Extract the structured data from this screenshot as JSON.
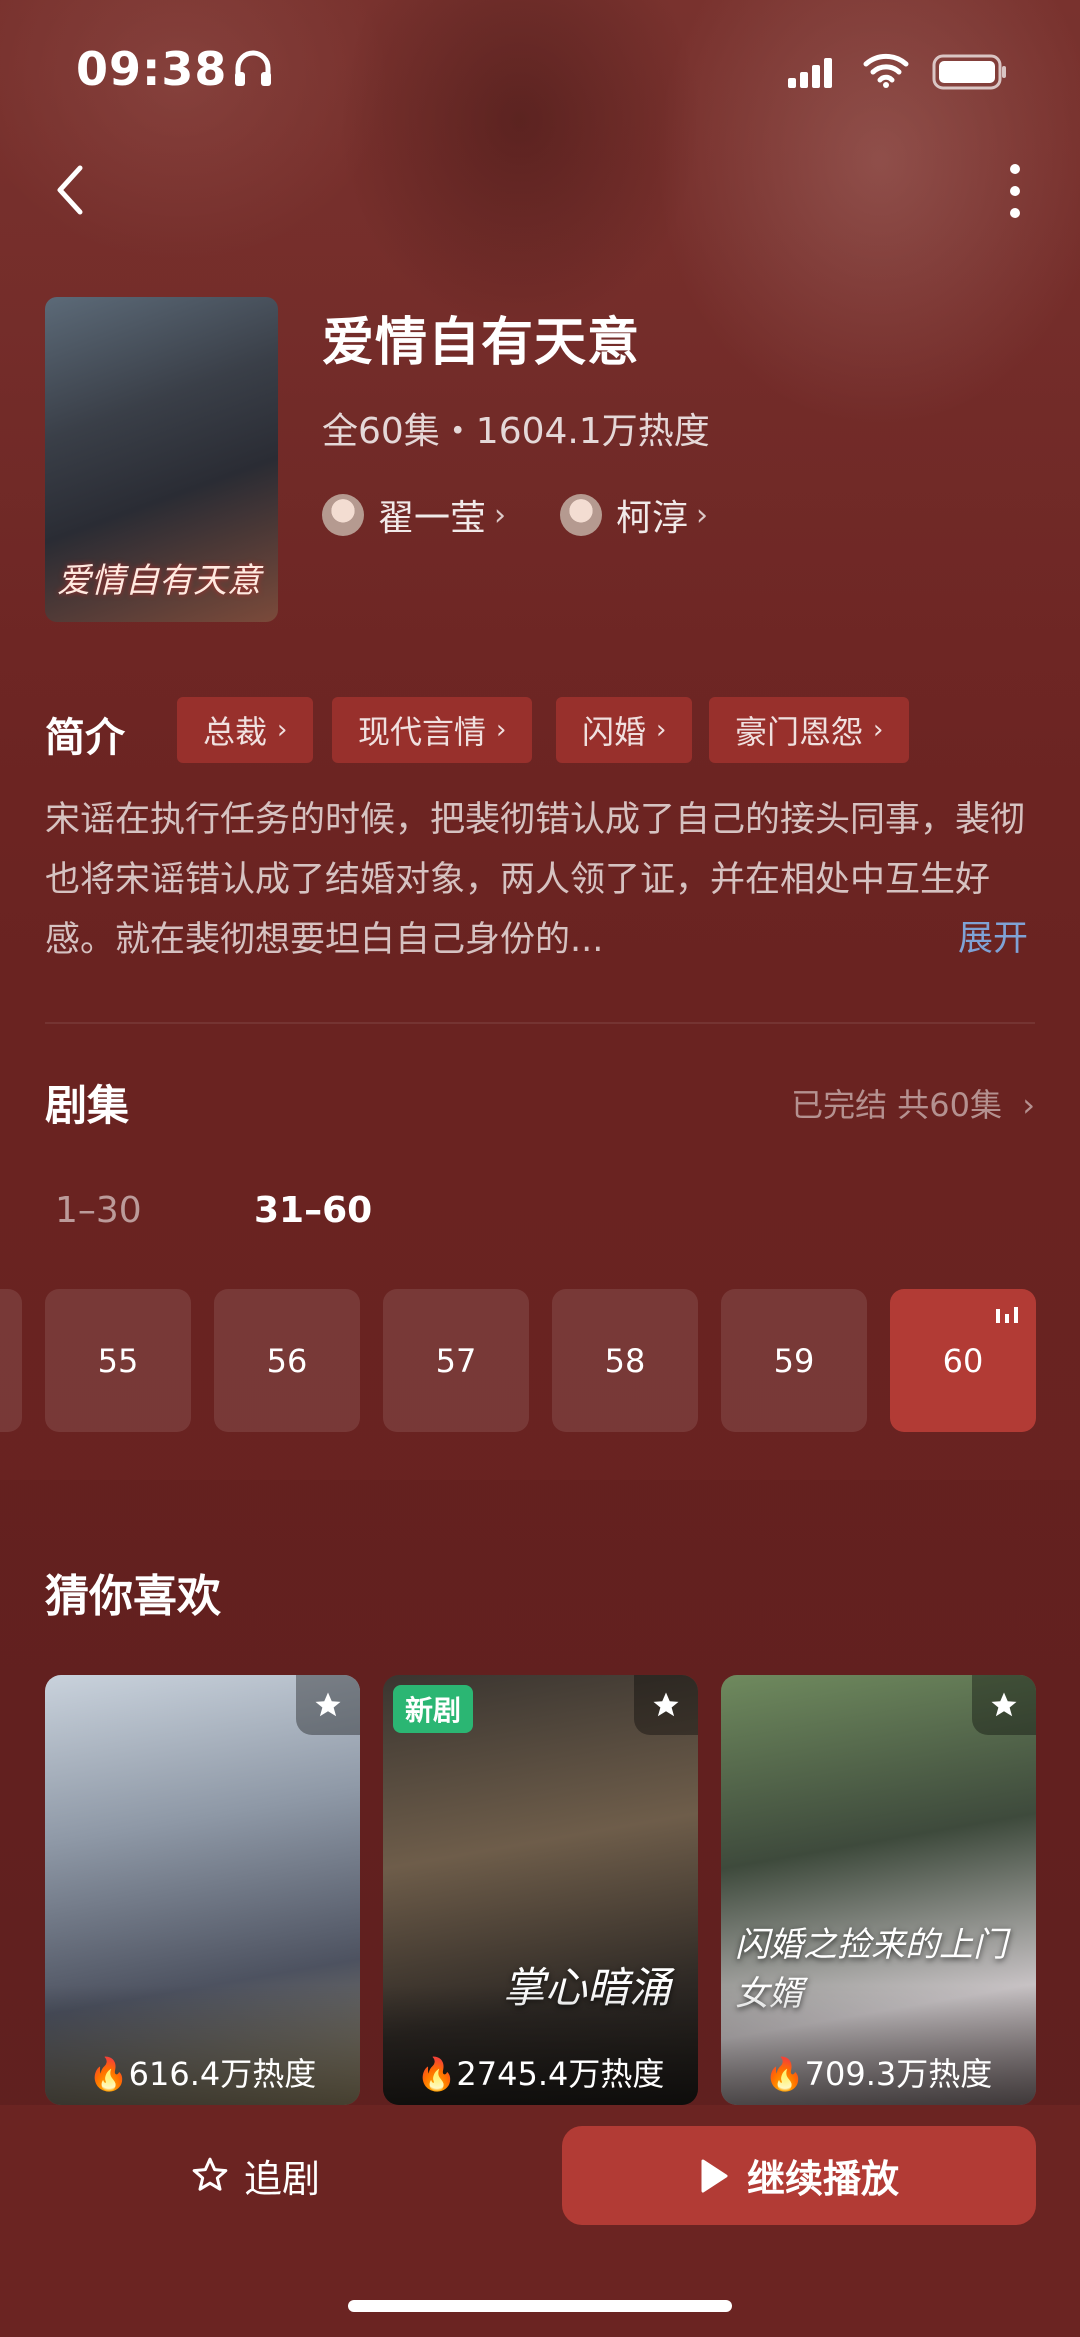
{
  "status_bar": {
    "time": "09:38"
  },
  "show": {
    "title": "爱情自有天意",
    "meta": "全60集・1604.1万热度",
    "poster_text": "爱情自有天意",
    "cast": [
      {
        "name": "翟一莹"
      },
      {
        "name": "柯淳"
      }
    ]
  },
  "intro": {
    "heading": "简介",
    "tags": [
      "总裁",
      "现代言情",
      "闪婚",
      "豪门恩怨"
    ],
    "synopsis": "宋谣在执行任务的时候，把裴彻错认成了自己的接头同事，裴彻也将宋谣错认成了结婚对象，两人领了证，并在相处中互生好感。就在裴彻想要坦白自己身份的...",
    "expand_label": "展开"
  },
  "episodes": {
    "heading": "剧集",
    "status": "已完结 共60集",
    "ranges": [
      "1–30",
      "31–60"
    ],
    "active_range": "31–60",
    "items": [
      "55",
      "56",
      "57",
      "58",
      "59",
      "60"
    ],
    "current": "60"
  },
  "recommendations": {
    "heading": "猜你喜欢",
    "items": [
      {
        "heat": "616.4万热度",
        "new": false
      },
      {
        "heat": "2745.4万热度",
        "new": true,
        "badge": "新剧",
        "overlay": "掌心暗涌"
      },
      {
        "heat": "709.3万热度",
        "new": false,
        "overlay": "闪婚之捡来的上门女婿"
      }
    ]
  },
  "bottom_bar": {
    "follow_label": "追剧",
    "play_label": "继续播放"
  },
  "colors": {
    "background": "#6b2422",
    "accent": "#b23b35",
    "link": "#7fa2d6",
    "new_badge": "#2bb673"
  }
}
